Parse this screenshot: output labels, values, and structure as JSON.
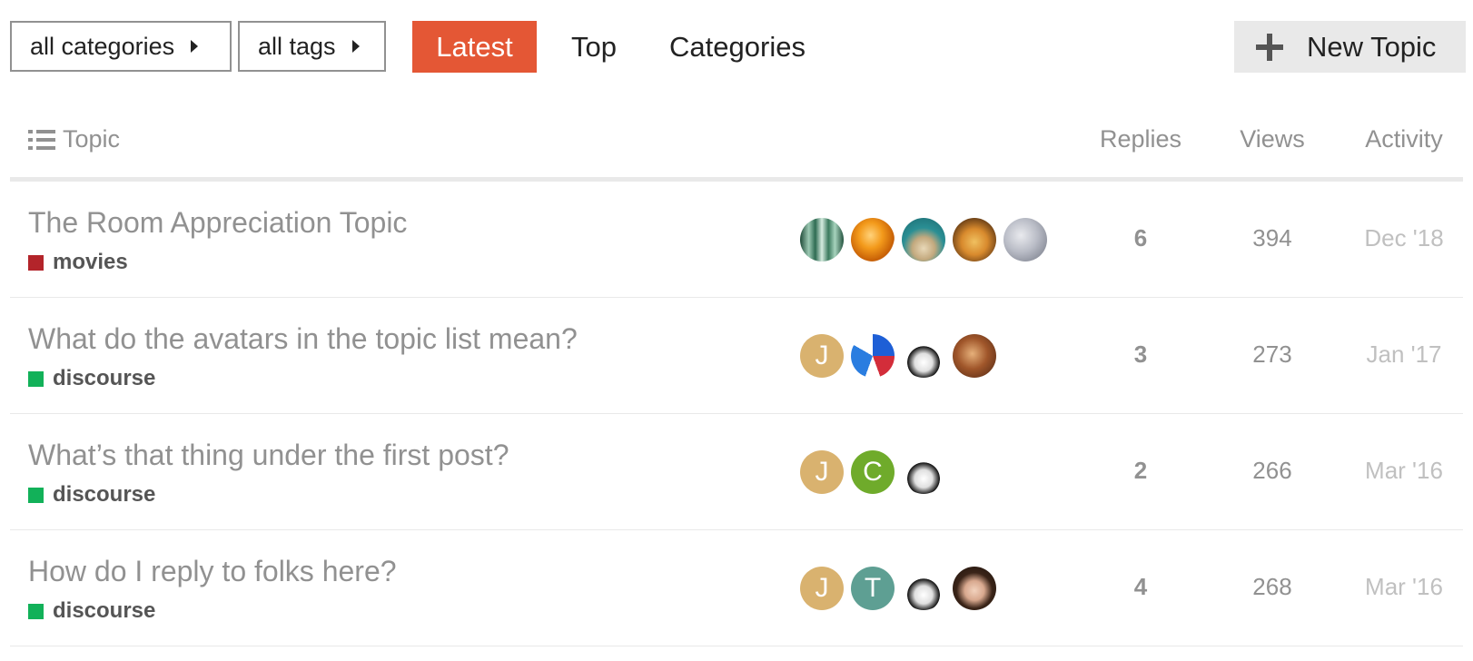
{
  "nav": {
    "category_dropdown": "all categories",
    "tags_dropdown": "all tags",
    "tabs": [
      "Latest",
      "Top",
      "Categories"
    ],
    "active_tab": "Latest",
    "new_topic_label": "New Topic",
    "accent_color": "#e45735"
  },
  "table": {
    "headers": {
      "topic": "Topic",
      "replies": "Replies",
      "views": "Views",
      "activity": "Activity"
    },
    "rows": [
      {
        "title": "The Room Appreciation Topic",
        "category": "movies",
        "category_color": "#b3242a",
        "replies": "6",
        "views": "394",
        "activity": "Dec '18",
        "avatars": [
          {
            "kind": "image",
            "style": "forest"
          },
          {
            "kind": "image",
            "style": "egg"
          },
          {
            "kind": "image",
            "style": "tophat-llama"
          },
          {
            "kind": "image",
            "style": "cartoon-face"
          },
          {
            "kind": "image",
            "style": "photo-gray"
          }
        ]
      },
      {
        "title": "What do the avatars in the topic list mean?",
        "category": "discourse",
        "category_color": "#12b159",
        "replies": "3",
        "views": "273",
        "activity": "Jan '17",
        "avatars": [
          {
            "kind": "letter",
            "letter": "J",
            "color": "#d9b26f"
          },
          {
            "kind": "image",
            "style": "blue-logo"
          },
          {
            "kind": "image",
            "style": "spiky-robot"
          },
          {
            "kind": "image",
            "style": "photo-brown"
          }
        ]
      },
      {
        "title": "What’s that thing under the first post?",
        "category": "discourse",
        "category_color": "#12b159",
        "replies": "2",
        "views": "266",
        "activity": "Mar '16",
        "avatars": [
          {
            "kind": "letter",
            "letter": "J",
            "color": "#d9b26f"
          },
          {
            "kind": "letter",
            "letter": "C",
            "color": "#6fab2b"
          },
          {
            "kind": "image",
            "style": "spiky-robot"
          }
        ]
      },
      {
        "title": "How do I reply to folks here?",
        "category": "discourse",
        "category_color": "#12b159",
        "replies": "4",
        "views": "268",
        "activity": "Mar '16",
        "avatars": [
          {
            "kind": "letter",
            "letter": "J",
            "color": "#d9b26f"
          },
          {
            "kind": "letter",
            "letter": "T",
            "color": "#5e9f93"
          },
          {
            "kind": "image",
            "style": "spiky-robot"
          },
          {
            "kind": "image",
            "style": "photo-woman"
          }
        ]
      }
    ]
  }
}
